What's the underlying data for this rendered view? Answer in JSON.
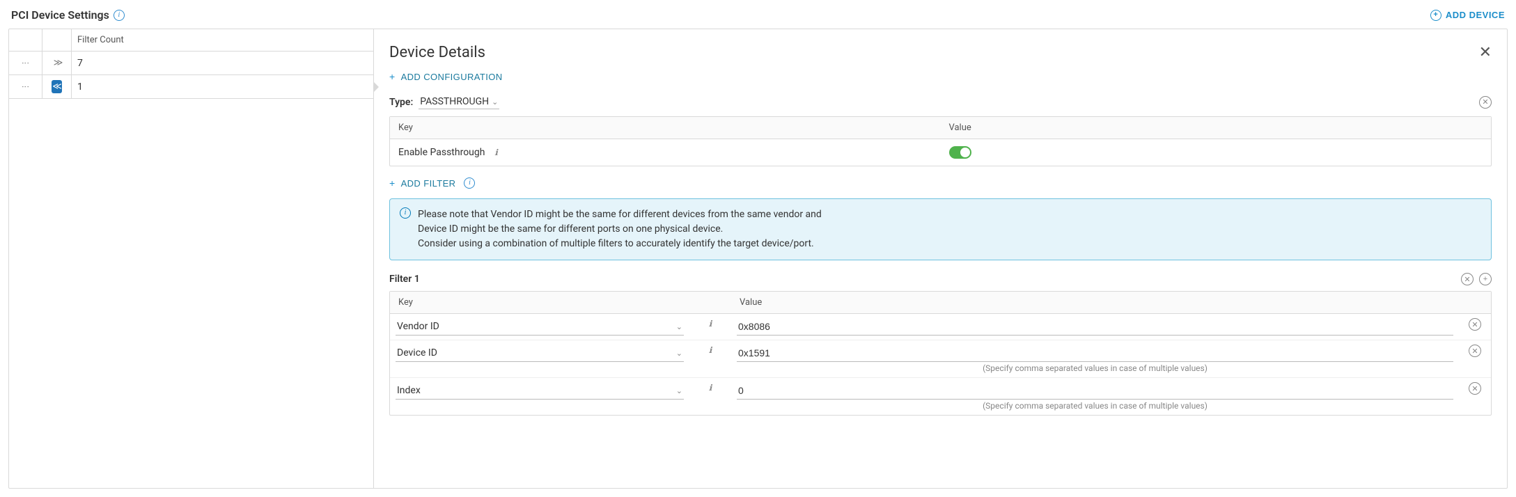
{
  "header": {
    "title": "PCI Device Settings",
    "add_device_label": "ADD DEVICE"
  },
  "left_panel": {
    "col_header": "Filter Count",
    "rows": [
      {
        "count": "7",
        "selected": false,
        "expand_state": "collapsed"
      },
      {
        "count": "1",
        "selected": true,
        "expand_state": "expanded"
      }
    ]
  },
  "details": {
    "title": "Device Details",
    "add_config_label": "ADD CONFIGURATION",
    "type_label": "Type:",
    "type_value": "PASSTHROUGH",
    "kv": {
      "key_header": "Key",
      "value_header": "Value",
      "enable_passthrough_label": "Enable Passthrough",
      "enable_passthrough_on": true
    },
    "add_filter_label": "ADD FILTER",
    "note": {
      "line1": "Please note that Vendor ID might be the same for different devices from the same vendor and",
      "line2": "Device ID might be the same for different ports on one physical device.",
      "line3": "Consider using a combination of multiple filters to accurately identify the target device/port."
    },
    "filter": {
      "title": "Filter 1",
      "key_header": "Key",
      "value_header": "Value",
      "rows": [
        {
          "key": "Vendor ID",
          "value": "0x8086",
          "hint": ""
        },
        {
          "key": "Device ID",
          "value": "0x1591",
          "hint": "(Specify comma separated values in case of multiple values)"
        },
        {
          "key": "Index",
          "value": "0",
          "hint": "(Specify comma separated values in case of multiple values)"
        }
      ]
    }
  }
}
